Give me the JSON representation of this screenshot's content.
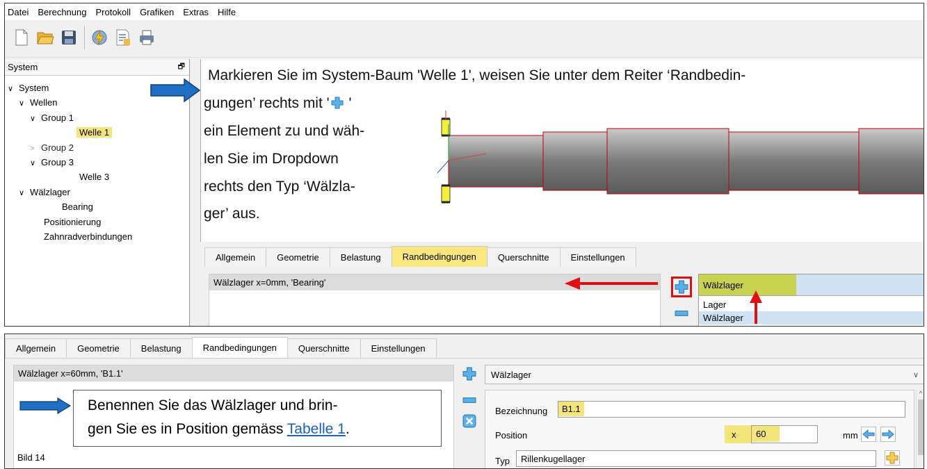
{
  "menu": {
    "items": [
      "Datei",
      "Berechnung",
      "Protokoll",
      "Grafiken",
      "Extras",
      "Hilfe"
    ]
  },
  "toolbar": {
    "icons": [
      "new-file-icon",
      "open-folder-icon",
      "save-icon",
      "calculate-icon",
      "report-icon",
      "print-icon"
    ]
  },
  "system_panel": {
    "title": "System",
    "pin_glyph": "🗗",
    "tree": [
      {
        "label": "System",
        "expander": "∨"
      },
      {
        "label": "Wellen",
        "expander": "∨"
      },
      {
        "label": "Group 1",
        "expander": "∨"
      },
      {
        "label": "Welle 1",
        "selected": true
      },
      {
        "label": "Group 2",
        "expander": ">"
      },
      {
        "label": "Group 3",
        "expander": "∨"
      },
      {
        "label": "Welle 3"
      },
      {
        "label": "Wälzlager",
        "expander": "∨"
      },
      {
        "label": "Bearing"
      },
      {
        "label": "Positionierung"
      },
      {
        "label": "Zahnradverbindungen"
      }
    ]
  },
  "instruction_top": {
    "line1": "Markieren Sie im System-Baum 'Welle 1', weisen Sie unter dem Reiter ‘Randbedin-",
    "line2a": "gungen’ rechts mit  '",
    "line2b": " '",
    "line3": "ein Element zu und wäh-",
    "line4": "len Sie im Dropdown",
    "line5": "rechts den Typ ‘Wälzla-",
    "line6": "ger’ aus."
  },
  "shaft_colors": {
    "body": "#8a8a8a",
    "outline": "#c00000",
    "bearing": "#f2ee3a"
  },
  "tabs_top": {
    "labels": [
      "Allgemein",
      "Geometrie",
      "Belastung",
      "Randbedingungen",
      "Querschnitte",
      "Einstellungen"
    ],
    "active": "Randbedingungen",
    "list_item": "Wälzlager  x=0mm, 'Bearing'",
    "dropdown": {
      "selected": "Wälzlager",
      "options": [
        "Lager",
        "Wälzlager"
      ]
    }
  },
  "bottom": {
    "tabs": [
      "Allgemein",
      "Geometrie",
      "Belastung",
      "Randbedingungen",
      "Querschnitte",
      "Einstellungen"
    ],
    "active": "Randbedingungen",
    "list_item": "Wälzlager  x=60mm, 'B1.1'",
    "type_select": "Wälzlager",
    "note_line1": "Benennen Sie das Wälzlager und brin-",
    "note_line2": "gen Sie es in Position gemäss ",
    "note_link": "Tabelle 1",
    "note_end": ".",
    "caption": "Bild 14",
    "fields": {
      "bezeichnung_label": "Bezeichnung",
      "bezeichnung_value": "B1.1",
      "position_label": "Position",
      "position_axis": "x",
      "position_value": "60",
      "position_unit": "mm",
      "typ_label": "Typ",
      "typ_value": "Rillenkugellager"
    }
  },
  "colors": {
    "accent_red": "#e01010",
    "arrow_blue": "#1f6fc4",
    "highlight_yellow": "#f3e57a",
    "active_tab": "#fae87f"
  }
}
